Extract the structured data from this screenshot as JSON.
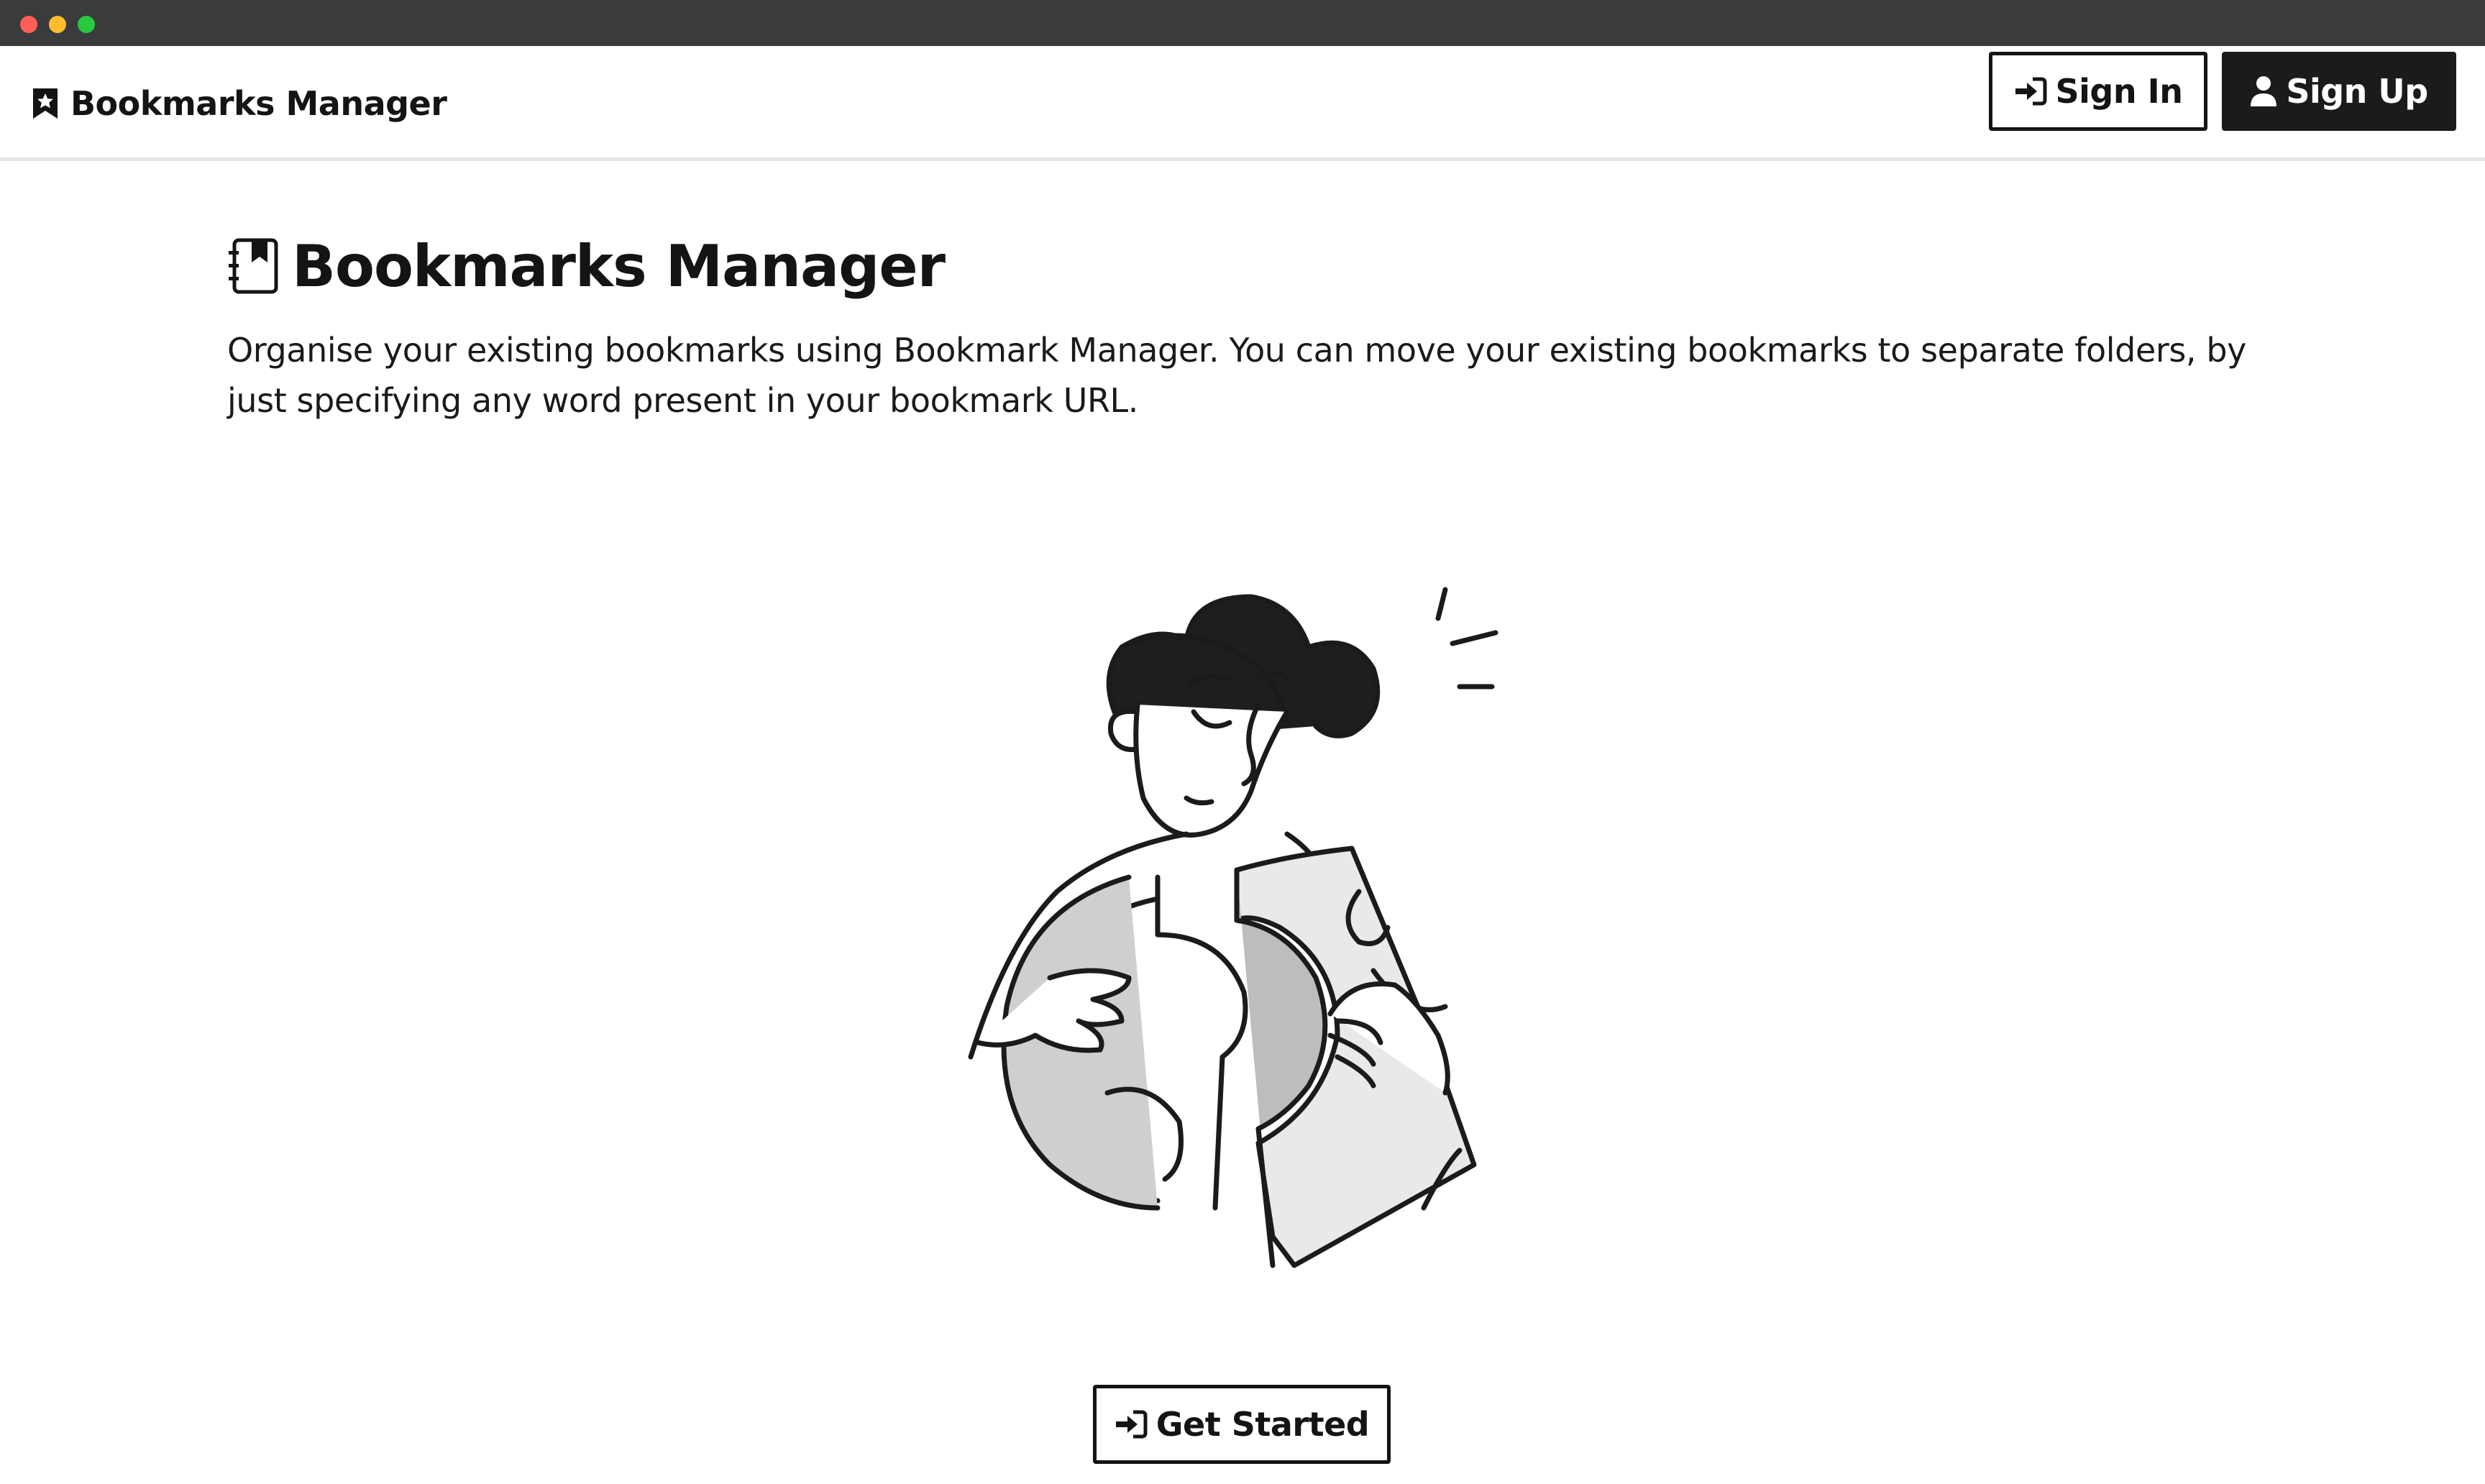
{
  "window": {
    "controls": [
      "close",
      "minimize",
      "maximize"
    ],
    "colors": {
      "close": "#ff5f57",
      "minimize": "#febc2e",
      "maximize": "#28c840",
      "titlebar": "#3a3b3d"
    }
  },
  "navbar": {
    "brand_icon": "bookmark-star-icon",
    "brand_label": "Bookmarks Manager",
    "signin": {
      "icon": "sign-in-icon",
      "label": "Sign In"
    },
    "signup": {
      "icon": "user-icon",
      "label": "Sign Up"
    }
  },
  "hero": {
    "icon": "bookmark-book-icon",
    "title": "Bookmarks Manager",
    "description": "Organise your existing bookmarks using Bookmark Manager. You can move your existing bookmarks to separate folders, by just specifying any word present in your bookmark URL.",
    "illustration": "person-holding-split-coin-illustration"
  },
  "cta": {
    "icon": "sign-in-icon",
    "label": "Get Started"
  },
  "colors": {
    "primary_dark": "#1b1b1b",
    "text": "#141414",
    "divider": "#e4e4e4",
    "background": "#ffffff"
  }
}
